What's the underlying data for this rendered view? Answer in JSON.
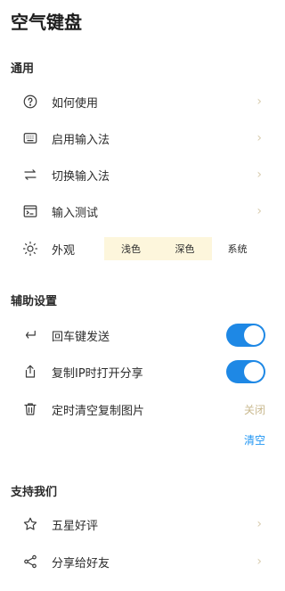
{
  "app": {
    "title": "空气键盘"
  },
  "general": {
    "title": "通用",
    "items": [
      {
        "label": "如何使用",
        "icon": "help-circle-icon",
        "chevron": "›"
      },
      {
        "label": "启用输入法",
        "icon": "keyboard-icon",
        "chevron": "›"
      },
      {
        "label": "切换输入法",
        "icon": "swap-arrows-icon",
        "chevron": "›"
      },
      {
        "label": "输入测试",
        "icon": "terminal-icon",
        "chevron": "›"
      }
    ],
    "appearance": {
      "label": "外观",
      "icon": "sun-icon",
      "options": [
        "浅色",
        "深色",
        "系统"
      ],
      "selected": [
        "浅色",
        "深色"
      ]
    }
  },
  "assist": {
    "title": "辅助设置",
    "enter_send": {
      "label": "回车键发送",
      "icon": "enter-return-icon",
      "enabled": true
    },
    "ip_share": {
      "label": "复制IP时打开分享",
      "icon": "share-upload-icon",
      "enabled": true
    },
    "clear_images": {
      "label": "定时清空复制图片",
      "icon": "trash-icon",
      "value": "关闭"
    },
    "clear_action": "清空"
  },
  "support": {
    "title": "支持我们",
    "items": [
      {
        "label": "五星好评",
        "icon": "star-icon",
        "chevron": "›"
      },
      {
        "label": "分享给好友",
        "icon": "share-nodes-icon",
        "chevron": "›"
      }
    ]
  },
  "colors": {
    "toggle_on": "#1e88e5",
    "link": "#2196f3",
    "segment_selected": "#fdf6dc"
  }
}
